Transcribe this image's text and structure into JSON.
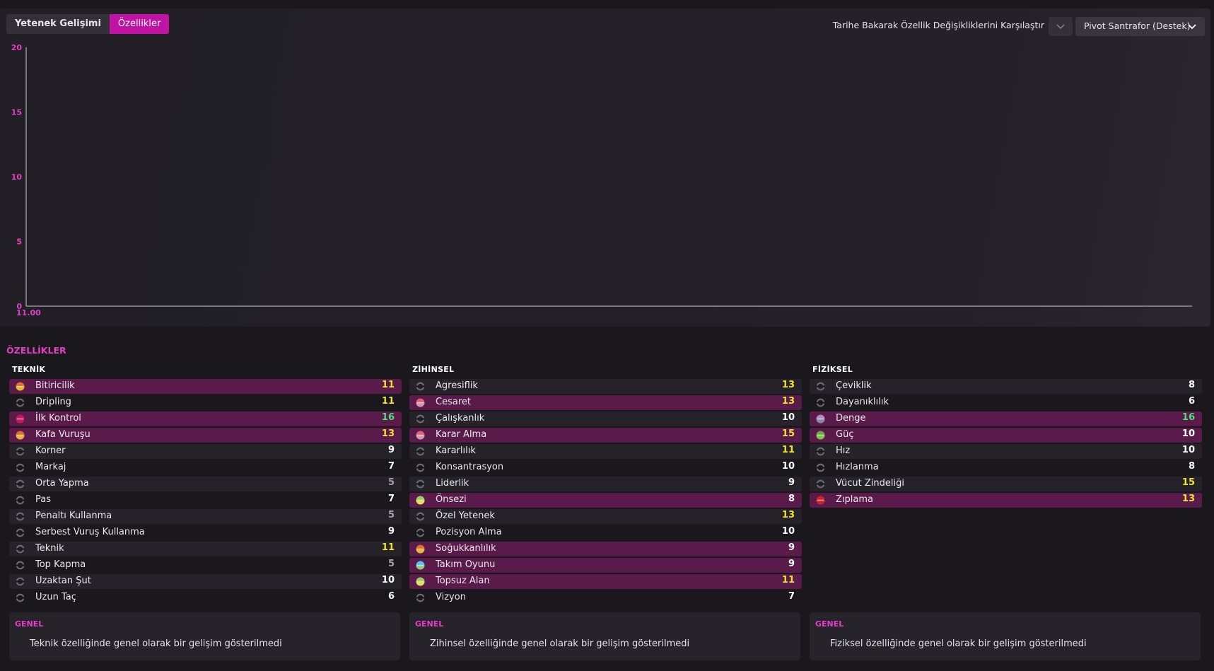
{
  "toolbar": {
    "tab_development": "Yetenek Gelişimi",
    "tab_attributes": "Özellikler",
    "compare_label": "Tarihe Bakarak Özellik Değişikliklerini Karşılaştır",
    "role_value": "Pivot Santrafor (Destek)"
  },
  "chart_data": {
    "type": "line",
    "title": "",
    "xlabel": "",
    "ylabel": "",
    "ylim": [
      0,
      20
    ],
    "y_ticks": [
      "0",
      "5",
      "10",
      "15",
      "20"
    ],
    "x_ticks": [
      "11.00"
    ],
    "series": []
  },
  "section_title": "ÖZELLİKLER",
  "colors": {
    "accent": "#c013a3",
    "accent_text": "#e33fc4",
    "value_white": "#ffffff",
    "value_yellow": "#f2e32c",
    "value_green": "#4ee07e",
    "value_grey": "#a7a3ab",
    "highlight_row": "#5b1b4a"
  },
  "columns": [
    {
      "title": "TEKNİK",
      "rows": [
        {
          "label": "Bitiricilik",
          "value": "11",
          "value_color": "yellow",
          "highlight": true,
          "icon": "key-attribute-icon",
          "icon_colors": [
            "#e46b2f",
            "#e8c52d"
          ]
        },
        {
          "label": "Dripling",
          "value": "11",
          "value_color": "yellow",
          "highlight": false,
          "icon": "neutral-icon",
          "icon_colors": []
        },
        {
          "label": "İlk Kontrol",
          "value": "16",
          "value_color": "green",
          "highlight": true,
          "icon": "key-attribute-icon",
          "icon_colors": [
            "#c2185b",
            "#c2185b"
          ]
        },
        {
          "label": "Kafa Vuruşu",
          "value": "13",
          "value_color": "yellow",
          "highlight": true,
          "icon": "key-attribute-icon",
          "icon_colors": [
            "#e46b2f",
            "#e8c52d"
          ]
        },
        {
          "label": "Korner",
          "value": "9",
          "value_color": "white",
          "highlight": false,
          "icon": "neutral-icon",
          "icon_colors": []
        },
        {
          "label": "Markaj",
          "value": "7",
          "value_color": "white",
          "highlight": false,
          "icon": "neutral-icon",
          "icon_colors": []
        },
        {
          "label": "Orta Yapma",
          "value": "5",
          "value_color": "grey",
          "highlight": false,
          "icon": "neutral-icon",
          "icon_colors": []
        },
        {
          "label": "Pas",
          "value": "7",
          "value_color": "white",
          "highlight": false,
          "icon": "neutral-icon",
          "icon_colors": []
        },
        {
          "label": "Penaltı Kullanma",
          "value": "5",
          "value_color": "grey",
          "highlight": false,
          "icon": "neutral-icon",
          "icon_colors": []
        },
        {
          "label": "Serbest Vuruş Kullanma",
          "value": "9",
          "value_color": "white",
          "highlight": false,
          "icon": "neutral-icon",
          "icon_colors": []
        },
        {
          "label": "Teknik",
          "value": "11",
          "value_color": "yellow",
          "highlight": false,
          "icon": "neutral-icon",
          "icon_colors": []
        },
        {
          "label": "Top Kapma",
          "value": "5",
          "value_color": "grey",
          "highlight": false,
          "icon": "neutral-icon",
          "icon_colors": []
        },
        {
          "label": "Uzaktan Şut",
          "value": "10",
          "value_color": "white",
          "highlight": false,
          "icon": "neutral-icon",
          "icon_colors": []
        },
        {
          "label": "Uzun Taç",
          "value": "6",
          "value_color": "white",
          "highlight": false,
          "icon": "neutral-icon",
          "icon_colors": []
        }
      ],
      "summary_title": "GENEL",
      "summary_text": "Teknik özelliğinde genel olarak bir gelişim gösterilmedi"
    },
    {
      "title": "ZİHİNSEL",
      "rows": [
        {
          "label": "Agresiflik",
          "value": "13",
          "value_color": "yellow",
          "highlight": false,
          "icon": "neutral-icon",
          "icon_colors": []
        },
        {
          "label": "Cesaret",
          "value": "13",
          "value_color": "yellow",
          "highlight": true,
          "icon": "key-attribute-icon",
          "icon_colors": [
            "#e0607a",
            "#c9a7b4"
          ]
        },
        {
          "label": "Çalışkanlık",
          "value": "10",
          "value_color": "white",
          "highlight": false,
          "icon": "neutral-icon",
          "icon_colors": []
        },
        {
          "label": "Karar Alma",
          "value": "15",
          "value_color": "yellow",
          "highlight": true,
          "icon": "key-attribute-icon",
          "icon_colors": [
            "#e0607a",
            "#c9a7b4"
          ]
        },
        {
          "label": "Kararlılık",
          "value": "11",
          "value_color": "yellow",
          "highlight": false,
          "icon": "neutral-icon",
          "icon_colors": []
        },
        {
          "label": "Konsantrasyon",
          "value": "10",
          "value_color": "white",
          "highlight": false,
          "icon": "neutral-icon",
          "icon_colors": []
        },
        {
          "label": "Liderlik",
          "value": "9",
          "value_color": "white",
          "highlight": false,
          "icon": "neutral-icon",
          "icon_colors": []
        },
        {
          "label": "Önsezi",
          "value": "8",
          "value_color": "white",
          "highlight": true,
          "icon": "key-attribute-icon",
          "icon_colors": [
            "#9ccc65",
            "#f0e05a"
          ]
        },
        {
          "label": "Özel Yetenek",
          "value": "13",
          "value_color": "yellow",
          "highlight": false,
          "icon": "neutral-icon",
          "icon_colors": []
        },
        {
          "label": "Pozisyon Alma",
          "value": "10",
          "value_color": "white",
          "highlight": false,
          "icon": "neutral-icon",
          "icon_colors": []
        },
        {
          "label": "Soğukkanlılık",
          "value": "9",
          "value_color": "white",
          "highlight": true,
          "icon": "key-attribute-icon",
          "icon_colors": [
            "#e46b2f",
            "#e8c52d"
          ]
        },
        {
          "label": "Takım Oyunu",
          "value": "9",
          "value_color": "white",
          "highlight": true,
          "icon": "key-attribute-icon",
          "icon_colors": [
            "#4fc3f7",
            "#9ccc65"
          ]
        },
        {
          "label": "Topsuz Alan",
          "value": "11",
          "value_color": "yellow",
          "highlight": true,
          "icon": "key-attribute-icon",
          "icon_colors": [
            "#9ccc65",
            "#f0e05a"
          ]
        },
        {
          "label": "Vizyon",
          "value": "7",
          "value_color": "white",
          "highlight": false,
          "icon": "neutral-icon",
          "icon_colors": []
        }
      ],
      "summary_title": "GENEL",
      "summary_text": "Zihinsel özelliğinde genel olarak bir gelişim gösterilmedi"
    },
    {
      "title": "FİZİKSEL",
      "rows": [
        {
          "label": "Çeviklik",
          "value": "8",
          "value_color": "white",
          "highlight": false,
          "icon": "neutral-icon",
          "icon_colors": []
        },
        {
          "label": "Dayanıklılık",
          "value": "6",
          "value_color": "white",
          "highlight": false,
          "icon": "neutral-icon",
          "icon_colors": []
        },
        {
          "label": "Denge",
          "value": "16",
          "value_color": "green",
          "highlight": true,
          "icon": "key-attribute-icon",
          "icon_colors": [
            "#b48ac6",
            "#7a8a9a"
          ]
        },
        {
          "label": "Güç",
          "value": "10",
          "value_color": "white",
          "highlight": true,
          "icon": "key-attribute-icon",
          "icon_colors": [
            "#6aa84f",
            "#8bc34a"
          ]
        },
        {
          "label": "Hız",
          "value": "10",
          "value_color": "white",
          "highlight": false,
          "icon": "neutral-icon",
          "icon_colors": []
        },
        {
          "label": "Hızlanma",
          "value": "8",
          "value_color": "white",
          "highlight": false,
          "icon": "neutral-icon",
          "icon_colors": []
        },
        {
          "label": "Vücut Zindeliği",
          "value": "15",
          "value_color": "yellow",
          "highlight": false,
          "icon": "neutral-icon",
          "icon_colors": []
        },
        {
          "label": "Zıplama",
          "value": "13",
          "value_color": "yellow",
          "highlight": true,
          "icon": "key-attribute-icon",
          "icon_colors": [
            "#c62828",
            "#c62828"
          ]
        }
      ],
      "summary_title": "GENEL",
      "summary_text": "Fiziksel özelliğinde genel olarak bir gelişim gösterilmedi"
    }
  ]
}
